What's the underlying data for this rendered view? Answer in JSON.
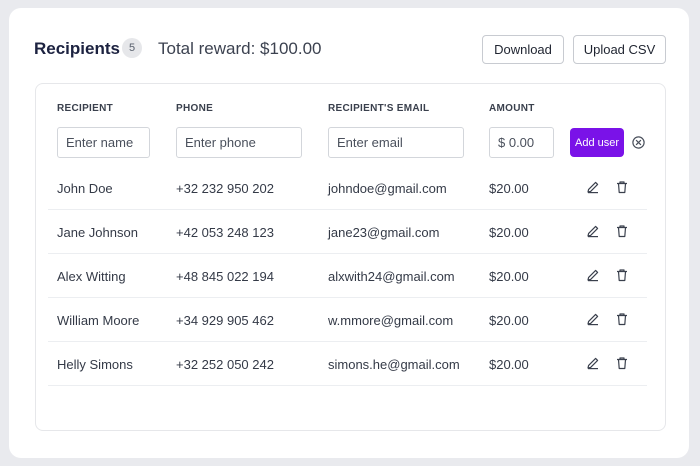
{
  "header": {
    "title": "Recipients",
    "count": "5",
    "reward_text": "Total reward: $100.00",
    "download_label": "Download",
    "upload_label": "Upload CSV"
  },
  "table": {
    "columns": [
      "RECIPIENT",
      "PHONE",
      "RECIPIENT'S EMAIL",
      "AMOUNT"
    ],
    "new_row": {
      "name_placeholder": "Enter name",
      "phone_placeholder": "Enter phone",
      "email_placeholder": "Enter email",
      "amount_placeholder": "$ 0.00",
      "add_label": "Add user"
    },
    "rows": [
      {
        "name": "John Doe",
        "phone": "+32 232 950 202",
        "email": "johndoe@gmail.com",
        "amount": "$20.00"
      },
      {
        "name": "Jane Johnson",
        "phone": "+42 053 248 123",
        "email": "jane23@gmail.com",
        "amount": "$20.00"
      },
      {
        "name": "Alex Witting",
        "phone": "+48 845 022 194",
        "email": "alxwith24@gmail.com",
        "amount": "$20.00"
      },
      {
        "name": "William Moore",
        "phone": "+34 929 905 462",
        "email": "w.mmore@gmail.com",
        "amount": "$20.00"
      },
      {
        "name": "Helly Simons",
        "phone": "+32 252 050 242",
        "email": "simons.he@gmail.com",
        "amount": "$20.00"
      }
    ]
  },
  "icons": {
    "row_actions": [
      "pencil-icon",
      "trash-icon"
    ],
    "clear": "close-circle-icon"
  },
  "colors": {
    "accent": "#7a12e8",
    "background": "#e9eaee"
  }
}
